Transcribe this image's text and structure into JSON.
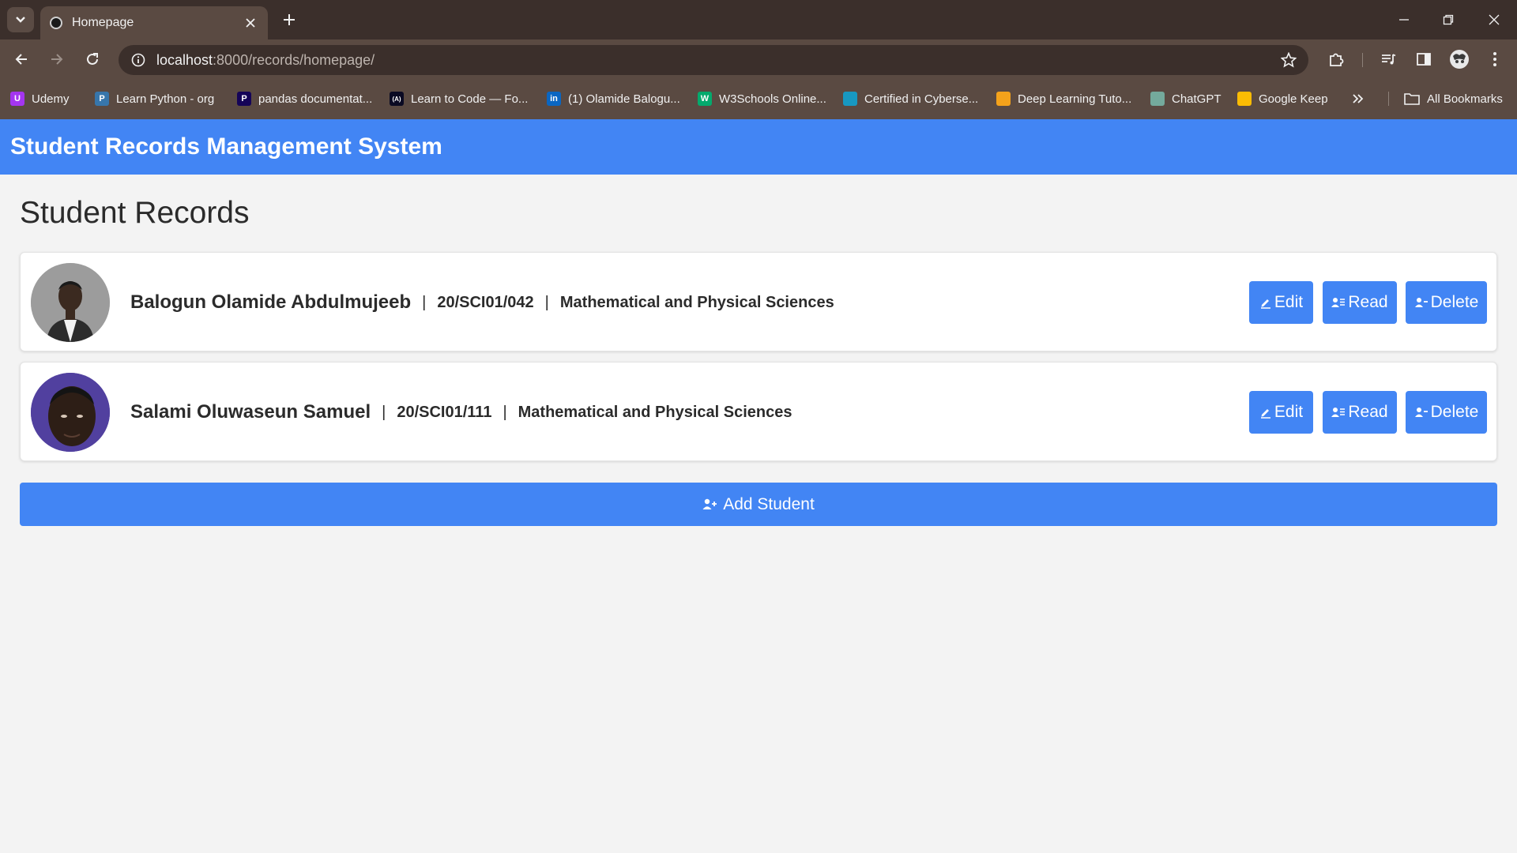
{
  "browser": {
    "tab_title": "Homepage",
    "url_host": "localhost",
    "url_rest": ":8000/records/homepage/",
    "bookmarks": [
      {
        "label": "Udemy",
        "icon": "udemy-icon",
        "color": "#a435f0"
      },
      {
        "label": "Learn Python - org",
        "icon": "python-icon",
        "color": "#3776ab"
      },
      {
        "label": "pandas documentat...",
        "icon": "pandas-icon",
        "color": "#150458"
      },
      {
        "label": "Learn to Code — Fo...",
        "icon": "freecodecamp-icon",
        "color": "#0a0a23"
      },
      {
        "label": "(1) Olamide Balogu...",
        "icon": "linkedin-icon",
        "color": "#0a66c2"
      },
      {
        "label": "W3Schools Online...",
        "icon": "w3schools-icon",
        "color": "#04aa6d"
      },
      {
        "label": "Certified in Cyberse...",
        "icon": "cloud-icon",
        "color": "#1798c1"
      },
      {
        "label": "Deep Learning Tuto...",
        "icon": "deeplearning-icon",
        "color": "#f4a21b"
      },
      {
        "label": "ChatGPT",
        "icon": "chatgpt-icon",
        "color": "#74aa9c"
      },
      {
        "label": "Google Keep",
        "icon": "keep-icon",
        "color": "#fbbc04"
      }
    ],
    "all_bookmarks_label": "All Bookmarks"
  },
  "header": {
    "title": "Student Records Management System",
    "color": "#4285f4"
  },
  "main": {
    "heading": "Student Records",
    "records": [
      {
        "name": "Balogun Olamide Abdulmujeeb",
        "matric": "20/SCI01/042",
        "faculty": "Mathematical and Physical Sciences"
      },
      {
        "name": "Salami Oluwaseun Samuel",
        "matric": "20/SCI01/111",
        "faculty": "Mathematical and Physical Sciences"
      }
    ],
    "separator": "|",
    "actions": {
      "edit": "Edit",
      "read": "Read",
      "delete": "Delete"
    },
    "add_button": "Add Student"
  }
}
